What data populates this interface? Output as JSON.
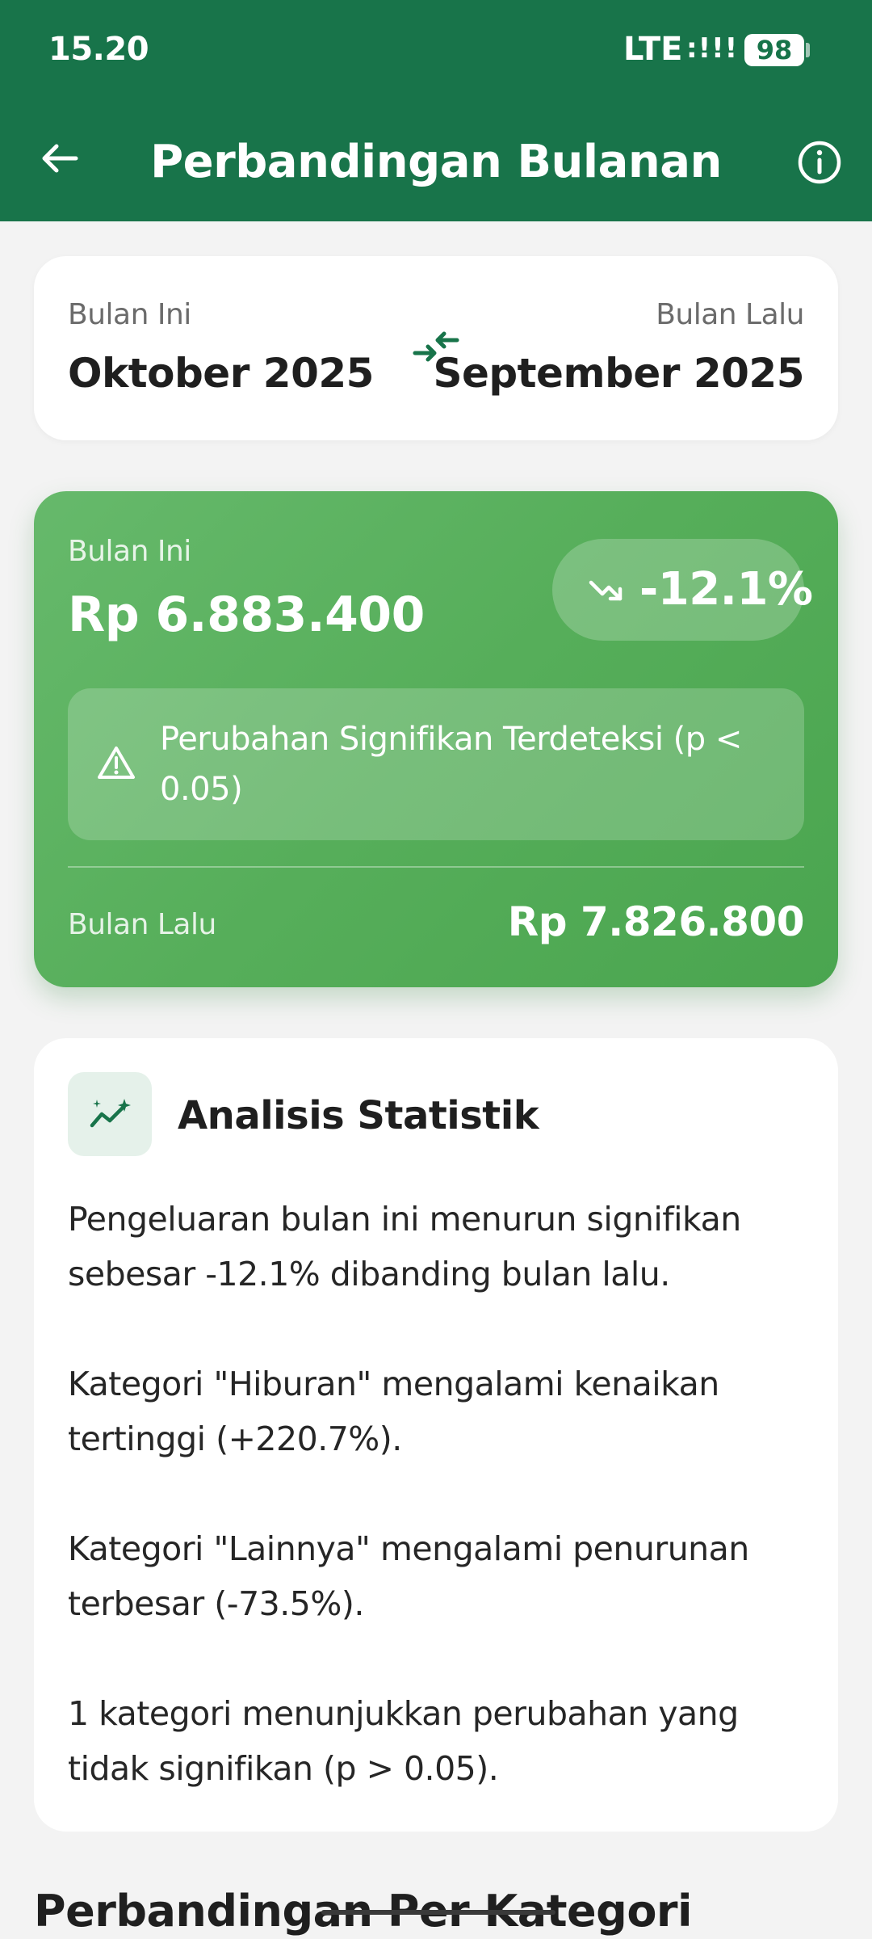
{
  "status_bar": {
    "time": "15.20",
    "network": "LTE",
    "signal": ":!!!",
    "battery": "98"
  },
  "app_bar": {
    "title": "Perbandingan Bulanan",
    "back_icon": "arrow-left-icon",
    "info_icon": "info-icon",
    "color": "#18744a"
  },
  "month_selector": {
    "current_label": "Bulan Ini",
    "current_value": "Oktober 2025",
    "previous_label": "Bulan Lalu",
    "previous_value": "September 2025",
    "swap_icon": "compare-arrows-icon"
  },
  "summary": {
    "current_label": "Bulan Ini",
    "current_amount": "Rp 6.883.400",
    "change_percent": "-12.1%",
    "trend_icon": "trending-down-icon",
    "warning_icon": "warning-triangle-icon",
    "warning_text": "Perubahan Signifikan Terdeteksi (p < 0.05)",
    "previous_label": "Bulan Lalu",
    "previous_amount": "Rp 7.826.800",
    "accent": "#56ae5a"
  },
  "analysis": {
    "icon": "sparkle-chart-icon",
    "title": "Analisis Statistik",
    "paragraphs": [
      "Pengeluaran bulan ini menurun signifikan sebesar -12.1% dibanding bulan lalu.",
      "Kategori \"Hiburan\" mengalami kenaikan tertinggi (+220.7%).",
      "Kategori \"Lainnya\" mengalami penurunan terbesar (-73.5%).",
      "1 kategori menunjukkan perubahan yang tidak signifikan (p > 0.05)."
    ]
  },
  "section": {
    "title": "Perbandingan Per Kategori"
  }
}
